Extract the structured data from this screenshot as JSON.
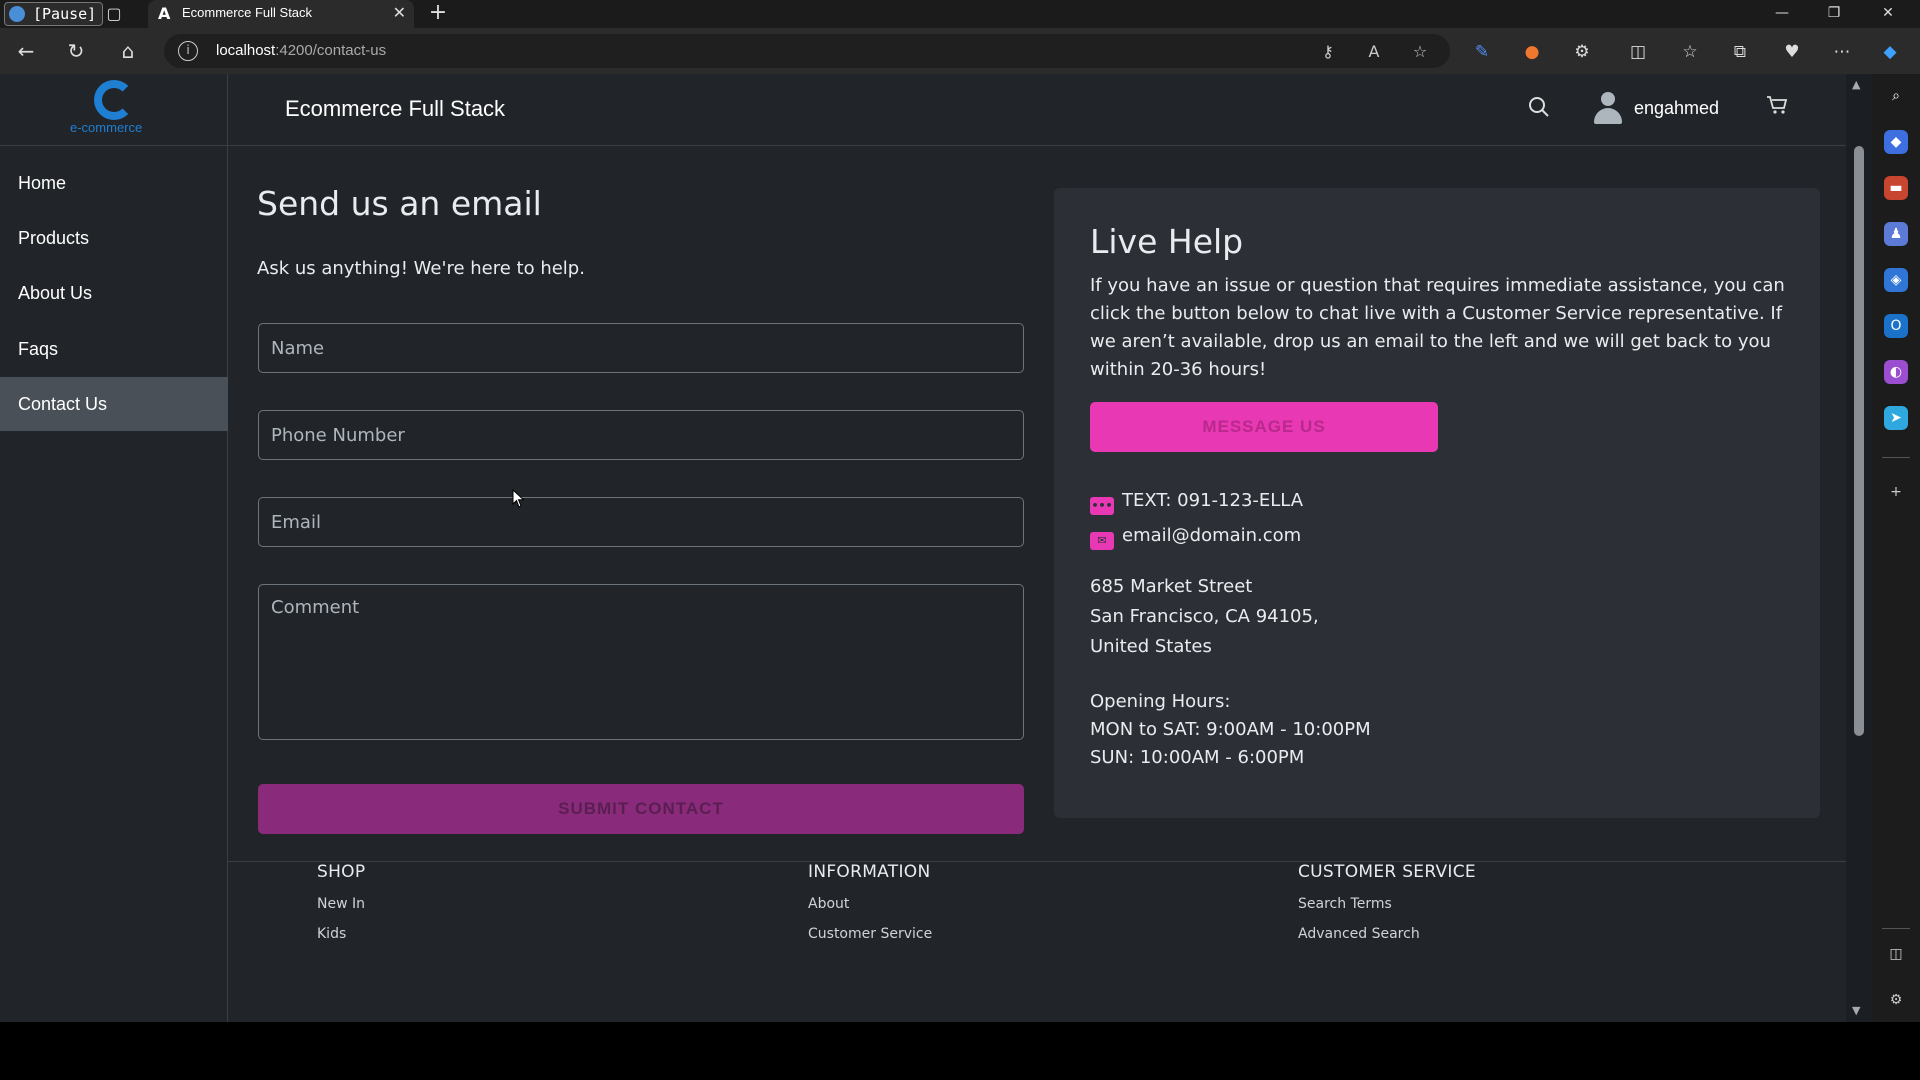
{
  "browser": {
    "pause_badge": "[Pause]",
    "tab_title": "Ecommerce Full Stack",
    "url_host": "localhost",
    "url_path": ":4200/contact-us"
  },
  "app": {
    "logo_text": "e-commerce",
    "brand": "Ecommerce Full Stack",
    "username": "engahmed",
    "sidebar": [
      {
        "label": "Home"
      },
      {
        "label": "Products"
      },
      {
        "label": "About Us"
      },
      {
        "label": "Faqs"
      },
      {
        "label": "Contact Us",
        "active": true
      }
    ]
  },
  "contact_form": {
    "heading": "Send us an email",
    "subheading": "Ask us anything! We're here to help.",
    "name_placeholder": "Name",
    "phone_placeholder": "Phone Number",
    "email_placeholder": "Email",
    "comment_placeholder": "Comment",
    "submit_label": "SUBMIT CONTACT"
  },
  "live_help": {
    "title": "Live Help",
    "text": "If you have an issue or question that requires immediate assistance, you can click the button below to chat live with a Customer Service representative. If we aren’t available, drop us an email to the left and we will get back to you within 20-36 hours!",
    "message_button": "MESSAGE US",
    "text_line": "TEXT: 091-123-ELLA",
    "email_line": "email@domain.com",
    "address_1": "685 Market Street",
    "address_2": "San Francisco, CA 94105,",
    "address_3": "United States",
    "hours_title": "Opening Hours:",
    "hours_weekday": "MON to SAT: 9:00AM - 10:00PM",
    "hours_sunday": "SUN: 10:00AM - 6:00PM"
  },
  "footer": {
    "shop": {
      "heading": "SHOP",
      "links": [
        "New In",
        "Kids"
      ]
    },
    "information": {
      "heading": "INFORMATION",
      "links": [
        "About",
        "Customer Service"
      ]
    },
    "customer_service": {
      "heading": "CUSTOMER SERVICE",
      "links": [
        "Search Terms",
        "Advanced Search"
      ]
    }
  },
  "colors": {
    "page_bg": "#212529",
    "card_bg": "#2c3036",
    "accent_pink": "#e838b4",
    "submit_purple": "#8a2a7a",
    "active_nav": "#495057"
  }
}
